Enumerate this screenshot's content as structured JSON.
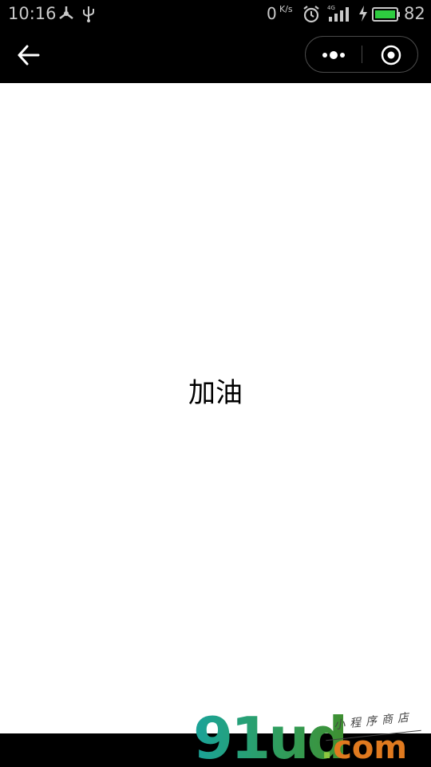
{
  "status_bar": {
    "time": "10:16",
    "net_speed_value": "0",
    "net_speed_unit": "K/s",
    "network_type": "4G",
    "battery_percent": "82",
    "icons": [
      "usb-share-icon",
      "usb-icon",
      "alarm-icon",
      "signal-icon",
      "charging-icon",
      "battery-icon"
    ]
  },
  "nav": {
    "back_icon": "arrow-left-icon",
    "more_icon": "more-dots-icon",
    "close_icon": "target-circle-icon"
  },
  "content": {
    "text": "加油"
  },
  "watermark": {
    "logo": "91ud",
    "dot": ".",
    "domain": "com",
    "slogan": "小程序商店"
  },
  "colors": {
    "status_bg": "#000000",
    "content_bg": "#ffffff",
    "text": "#000000",
    "battery_fill": "#2ecc40",
    "watermark_green": "#2f9e5f",
    "watermark_orange": "#e07a1f"
  }
}
